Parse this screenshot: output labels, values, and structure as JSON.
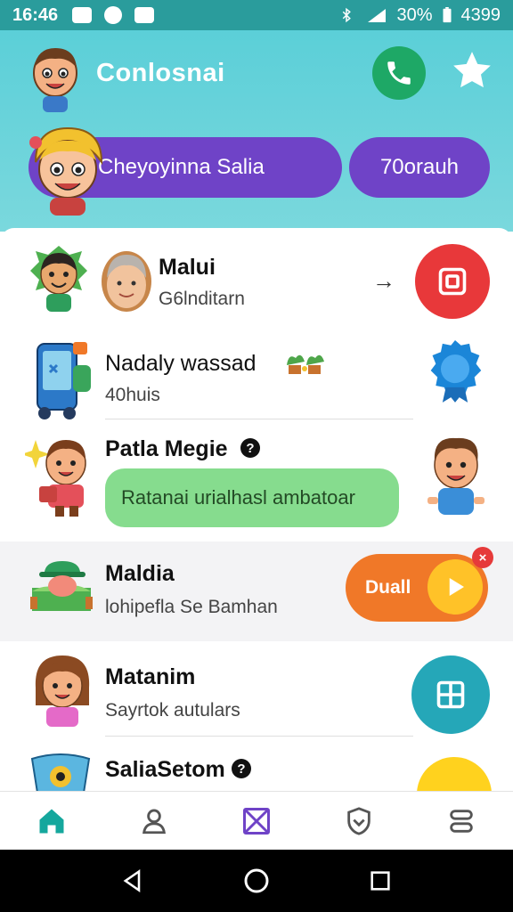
{
  "status": {
    "time": "16:46",
    "battery": "30%",
    "extra": "4399"
  },
  "header": {
    "title": "Conlosnai",
    "primary_pill": "Cheyoyinna Salia",
    "secondary_pill": "70orauh"
  },
  "contacts": [
    {
      "name": "Malui",
      "sub": "G6lnditarn",
      "arrow": "→"
    },
    {
      "name": "Nadaly wassad",
      "sub": "40huis"
    },
    {
      "name": "Patla Megie",
      "sub": "",
      "bubble": "Ratanai urialhasl ambatoar"
    },
    {
      "name": "Maldia",
      "sub": "lohipefla Se Bamhan",
      "action": "Duall",
      "badge": "×"
    },
    {
      "name": "Matanim",
      "sub": "Sayrtok autulars"
    },
    {
      "name": "SaliaSetom",
      "sub": ""
    }
  ],
  "colors": {
    "teal": "#5bcfd8",
    "purple": "#6f43c7",
    "green": "#86dc8e",
    "orange": "#f07828",
    "red": "#e8383a",
    "blue": "#1b86d8",
    "cyan": "#25a7b8",
    "yellow": "#ffd21e"
  },
  "nav": {
    "items": [
      "home-icon",
      "profile-icon",
      "mail-icon",
      "shield-icon",
      "menu-icon"
    ],
    "active": "home-icon"
  }
}
